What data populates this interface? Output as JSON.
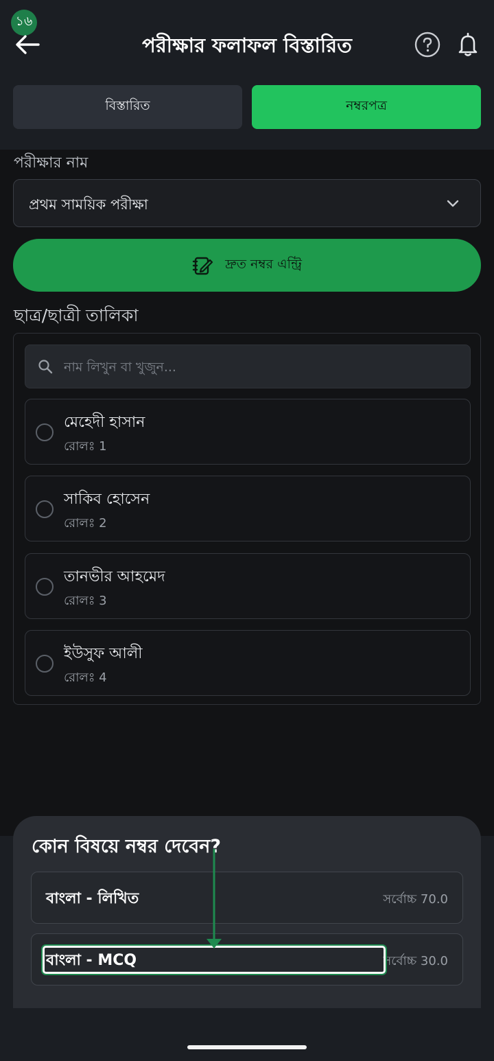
{
  "header": {
    "step_badge": "১৬",
    "title": "পরীক্ষার ফলাফল বিস্তারিত"
  },
  "tabs": [
    {
      "label": "বিস্তারিত",
      "active": false
    },
    {
      "label": "নম্বরপত্র",
      "active": true
    }
  ],
  "exam": {
    "label": "পরীক্ষার নাম",
    "selected": "প্রথম সাময়িক পরীক্ষা"
  },
  "quick_entry": {
    "label": "দ্রুত নম্বর এন্ট্রি"
  },
  "students": {
    "title": "ছাত্র/ছাত্রী তালিকা",
    "search_placeholder": "নাম লিখুন বা খুজুন...",
    "items": [
      {
        "name": "মেহেদী হাসান",
        "roll": "রোলঃ 1"
      },
      {
        "name": "সাকিব হোসেন",
        "roll": "রোলঃ 2"
      },
      {
        "name": "তানভীর আহমেদ",
        "roll": "রোলঃ 3"
      },
      {
        "name": "ইউসুফ আলী",
        "roll": "রোলঃ 4"
      }
    ]
  },
  "subject_sheet": {
    "title": "কোন বিষয়ে নম্বর দেবেন?",
    "subjects": [
      {
        "name": "বাংলা - লিখিত",
        "max": "সর্বোচ্চ 70.0"
      },
      {
        "name": "বাংলা - MCQ",
        "max": "সর্বোচ্চ 30.0"
      }
    ]
  },
  "colors": {
    "accent": "#22c35e",
    "button": "#1e9a4c",
    "background": "#1b1e23"
  }
}
